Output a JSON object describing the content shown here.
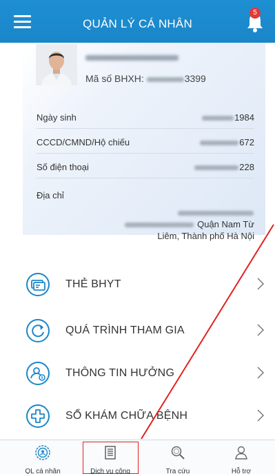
{
  "header": {
    "title": "QUẢN LÝ CÁ NHÂN",
    "notification_count": "5",
    "color": "#1e8fd3"
  },
  "profile": {
    "bhxh_label": "Mã số BHXH:",
    "bhxh_suffix": "3399",
    "rows": [
      {
        "label": "Ngày sinh",
        "value_suffix": "1984"
      },
      {
        "label": "CCCD/CMND/Hộ chiếu",
        "value_suffix": "672"
      },
      {
        "label": "Số điện thoại",
        "value_suffix": "228"
      }
    ],
    "address_label": "Địa chỉ",
    "address_line1": "Quận Nam Từ",
    "address_line2": "Liêm, Thành phố Hà Nội"
  },
  "menu": [
    {
      "label": "THẺ BHYT",
      "icon": "card-icon"
    },
    {
      "label": "QUÁ TRÌNH THAM GIA",
      "icon": "history-icon"
    },
    {
      "label": "THÔNG TIN HƯỞNG",
      "icon": "benefit-icon"
    },
    {
      "label": "SỔ KHÁM CHỮA BỆNH",
      "icon": "medical-cross-icon"
    }
  ],
  "bottom_nav": [
    {
      "label": "QL cá nhân",
      "icon": "user-gear-icon"
    },
    {
      "label": "Dịch vụ công",
      "icon": "document-icon"
    },
    {
      "label": "Tra cứu",
      "icon": "magnifier-icon"
    },
    {
      "label": "Hỗ trợ",
      "icon": "support-person-icon"
    }
  ],
  "colors": {
    "accent": "#1e8fd3",
    "annotation": "#e02020",
    "badge": "#e53935"
  }
}
